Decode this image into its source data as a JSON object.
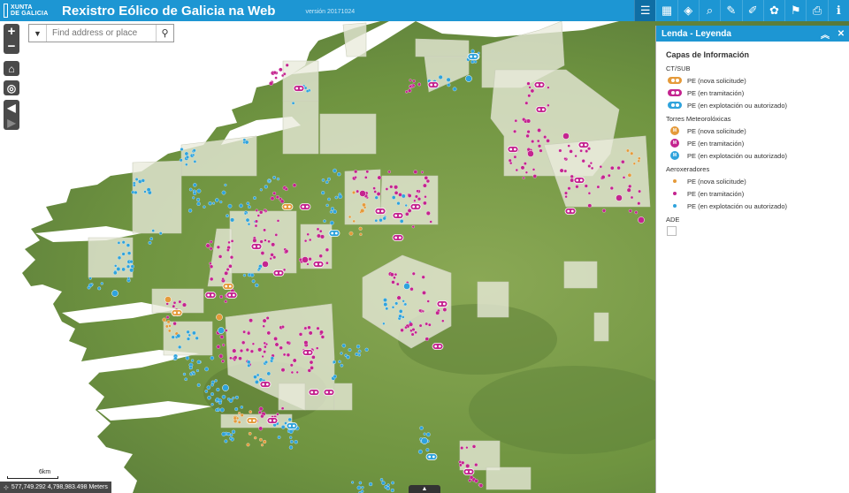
{
  "header": {
    "logo_line1": "XUNTA",
    "logo_line2": "DE GALICIA",
    "title": "Rexistro Eólico de Galicia na Web",
    "version": "versión 20171024"
  },
  "toolbar": [
    {
      "name": "legend-list-icon",
      "glyph": "☰",
      "active": true
    },
    {
      "name": "basemap-gallery-icon",
      "glyph": "▦"
    },
    {
      "name": "layers-icon",
      "glyph": "◈"
    },
    {
      "name": "query-search-icon",
      "glyph": "⌕"
    },
    {
      "name": "identify-icon",
      "glyph": "✎"
    },
    {
      "name": "measure-icon",
      "glyph": "✐"
    },
    {
      "name": "draw-icon",
      "glyph": "✿"
    },
    {
      "name": "bookmark-icon",
      "glyph": "⚑"
    },
    {
      "name": "print-icon",
      "glyph": "⎙"
    },
    {
      "name": "info-icon",
      "glyph": "ℹ"
    }
  ],
  "search": {
    "placeholder": "Find address or place"
  },
  "map": {
    "scale_label": "6km",
    "coordinates": "577,749.292 4,798,983.498 Meters",
    "colors": {
      "land": "#6f9440",
      "land_light": "#8aa855",
      "land_dark": "#4f6e2e",
      "ocean": "#ffffff",
      "ade": "#e9ebdb",
      "solicitude": "#e59a3a",
      "tramitacion": "#c4248f",
      "explotacion": "#2fa3dc"
    }
  },
  "legend": {
    "panel_title": "Lenda - Leyenda",
    "section_title": "Capas de Información",
    "groups": [
      {
        "label": "CT/SUB",
        "items": [
          "PE (nova solicitude)",
          "PE (en tramitación)",
          "PE (en explotación ou autorizado)"
        ]
      },
      {
        "label": "Torres Meteorolóxicas",
        "items": [
          "PE (nova solicitude)",
          "PE (en tramitación)",
          "PE (en explotación ou autorizado)"
        ],
        "letter": "M"
      },
      {
        "label": "Aeroxeradores",
        "items": [
          "PE (nova solicitude)",
          "PE (en tramitación)",
          "PE (en explotación ou autorizado)"
        ]
      },
      {
        "label": "ADE",
        "items": []
      }
    ]
  }
}
